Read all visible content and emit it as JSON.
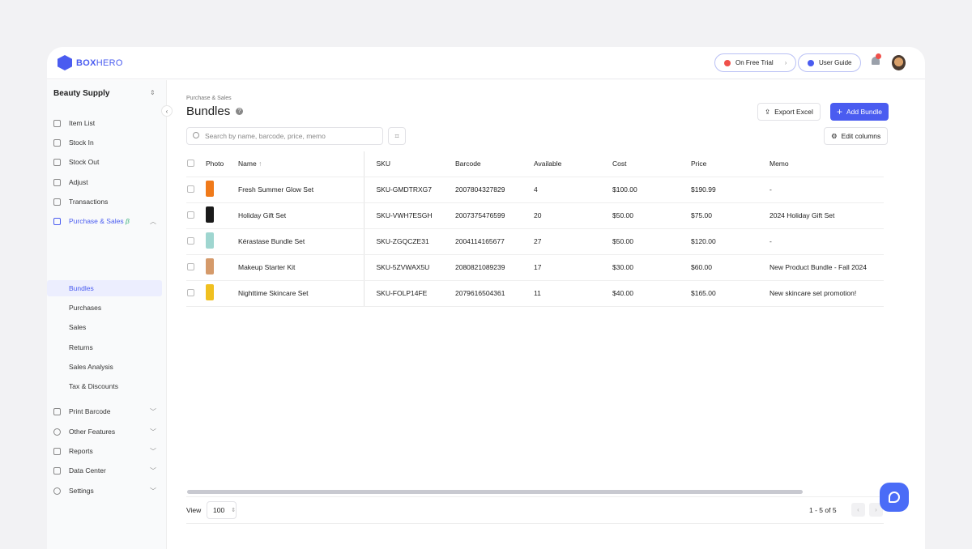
{
  "brand": {
    "name_bold": "BOX",
    "name_light": "HERO",
    "color": "#4a5cf0"
  },
  "header": {
    "trial": "On Free Trial",
    "guide": "User Guide",
    "notification_count": "5"
  },
  "sidebar": {
    "workspace": "Beauty Supply",
    "items": [
      {
        "label": "Item List",
        "icon": "box-icon"
      },
      {
        "label": "Stock In",
        "icon": "download-icon"
      },
      {
        "label": "Stock Out",
        "icon": "upload-icon"
      },
      {
        "label": "Adjust",
        "icon": "swap-icon"
      },
      {
        "label": "Transactions",
        "icon": "ledger-icon"
      }
    ],
    "purchase": {
      "label": "Purchase & Sales",
      "badge": "β",
      "sub": [
        "Bundles",
        "Purchases",
        "Sales",
        "Returns",
        "Sales Analysis",
        "Tax & Discounts"
      ]
    },
    "bottom": [
      {
        "label": "Print Barcode"
      },
      {
        "label": "Other Features"
      },
      {
        "label": "Reports"
      },
      {
        "label": "Data Center"
      },
      {
        "label": "Settings"
      }
    ]
  },
  "main": {
    "breadcrumb": "Purchase & Sales",
    "title": "Bundles",
    "search_placeholder": "Search by name, barcode, price, memo",
    "export": "Export Excel",
    "add": "Add Bundle",
    "edit_columns": "Edit columns",
    "columns": [
      "Photo",
      "Name",
      "SKU",
      "Barcode",
      "Available",
      "Cost",
      "Price",
      "Memo"
    ],
    "rows": [
      {
        "color": "#f07a1a",
        "name": "Fresh Summer Glow Set",
        "sku": "SKU-GMDTRXG7",
        "barcode": "2007804327829",
        "available": "4",
        "cost": "$100.00",
        "price": "$190.99",
        "memo": "-"
      },
      {
        "color": "#1a1a1a",
        "name": "Holiday Gift Set",
        "sku": "SKU-VWH7ESGH",
        "barcode": "2007375476599",
        "available": "20",
        "cost": "$50.00",
        "price": "$75.00",
        "memo": "2024 Holiday Gift Set"
      },
      {
        "color": "#9fd6d0",
        "name": "Kérastase Bundle Set",
        "sku": "SKU-ZGQCZE31",
        "barcode": "2004114165677",
        "available": "27",
        "cost": "$50.00",
        "price": "$120.00",
        "memo": "-"
      },
      {
        "color": "#d59a6a",
        "name": "Makeup Starter Kit",
        "sku": "SKU-5ZVWAX5U",
        "barcode": "2080821089239",
        "available": "17",
        "cost": "$30.00",
        "price": "$60.00",
        "memo": "New Product Bundle - Fall 2024"
      },
      {
        "color": "#f0c020",
        "name": "Nighttime Skincare Set",
        "sku": "SKU-FOLP14FE",
        "barcode": "2079616504361",
        "available": "11",
        "cost": "$40.00",
        "price": "$165.00",
        "memo": "New skincare set promotion!"
      }
    ],
    "footer": {
      "view_label": "View",
      "per_page": "100",
      "range": "1 - 5 of 5"
    }
  }
}
